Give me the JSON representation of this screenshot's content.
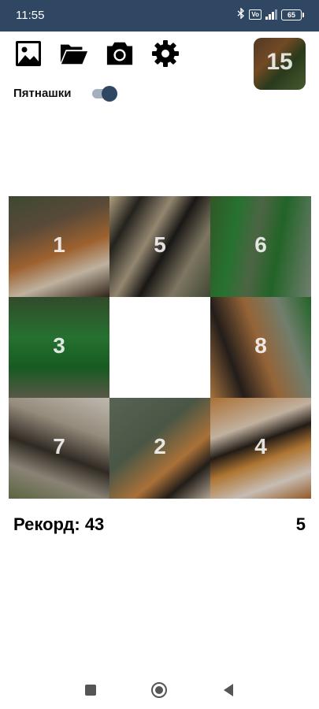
{
  "status_bar": {
    "time": "11:55",
    "network_label": "Vo\nLTE",
    "battery_level": "65"
  },
  "toolbar": {
    "icons": [
      "image-icon",
      "folder-open-icon",
      "camera-icon",
      "settings-gear-icon"
    ]
  },
  "preview": {
    "number": "15"
  },
  "mode_toggle": {
    "label": "Пятнашки",
    "state": "on"
  },
  "board": {
    "grid_size": 3,
    "tiles": [
      {
        "number": "1",
        "image": "tiger-ear"
      },
      {
        "number": "5",
        "image": "tiger-stripes"
      },
      {
        "number": "6",
        "image": "grass"
      },
      {
        "number": "3",
        "image": "grass-tiger"
      },
      {
        "number": "",
        "image": "empty"
      },
      {
        "number": "8",
        "image": "tiger-grass"
      },
      {
        "number": "7",
        "image": "fur"
      },
      {
        "number": "2",
        "image": "tiger-rock"
      },
      {
        "number": "4",
        "image": "tiger-face"
      }
    ]
  },
  "stats": {
    "record": "Рекорд: 43",
    "moves": "5"
  },
  "colors": {
    "status_bar": "#2f4762",
    "accent": "#2f4762",
    "text": "#000000"
  }
}
